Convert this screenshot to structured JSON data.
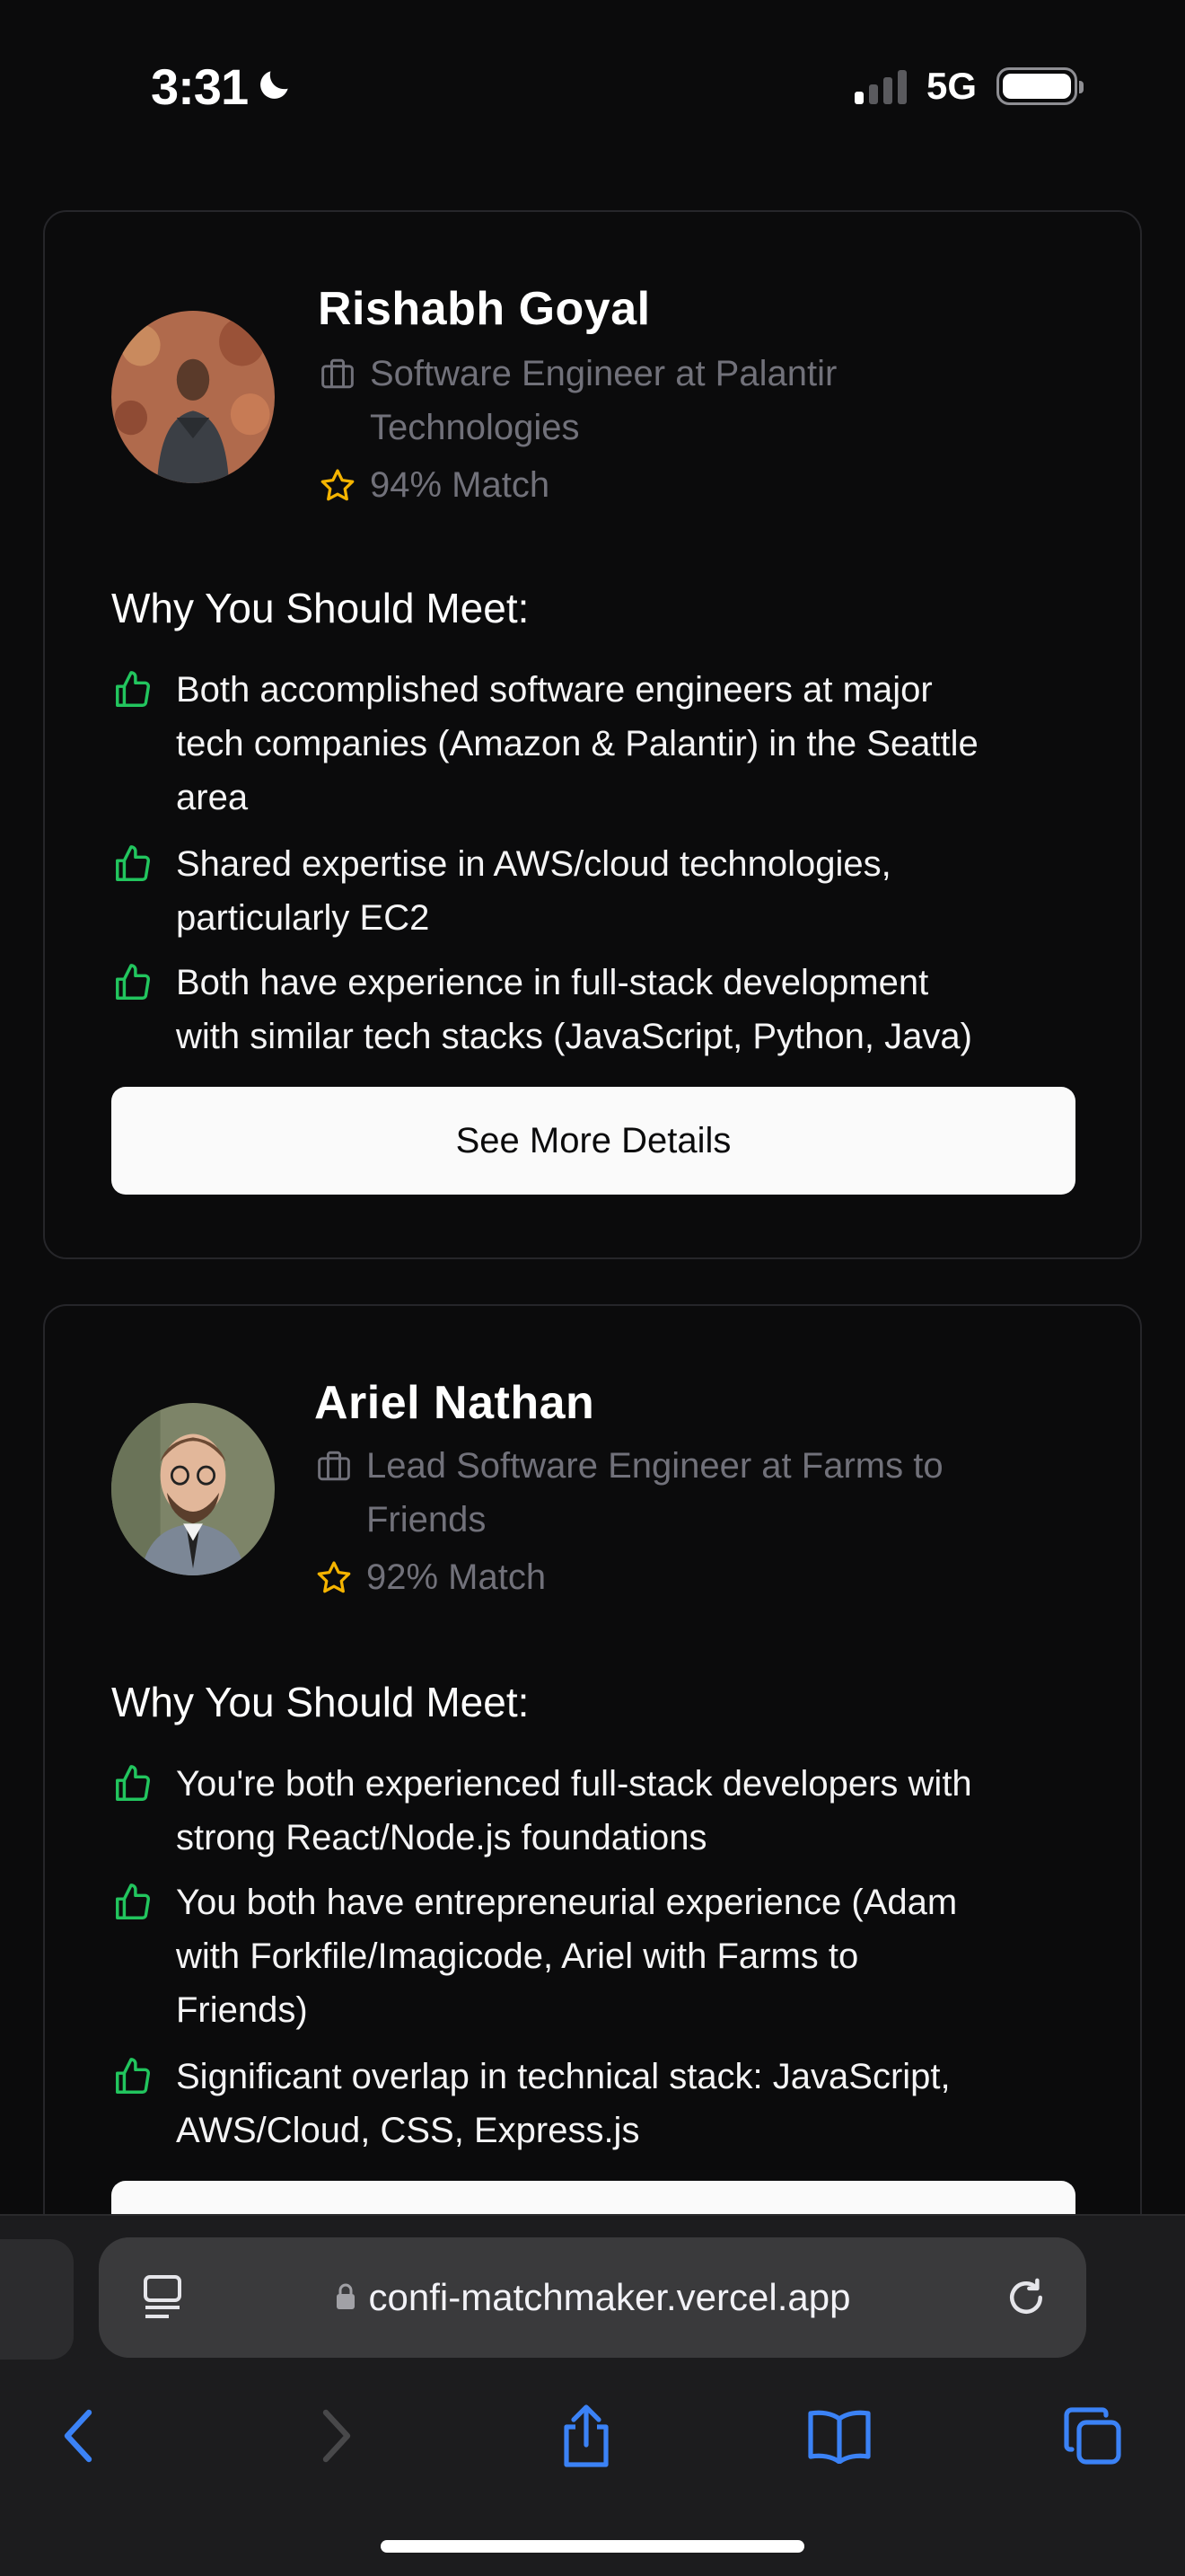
{
  "status_bar": {
    "time": "3:31",
    "network": "5G",
    "moon_icon": "moon-icon",
    "signal_bars_active": 1,
    "signal_bars_total": 4
  },
  "cards": [
    {
      "name": "Rishabh Goyal",
      "role_line1": "Software Engineer at Palantir",
      "role_line2": "Technologies",
      "match": "94% Match",
      "why_title": "Why You Should Meet:",
      "reasons": [
        [
          "Both accomplished software engineers at major",
          "tech companies (Amazon & Palantir) in the Seattle",
          "area"
        ],
        [
          "Shared expertise in AWS/cloud technologies,",
          "particularly EC2"
        ],
        [
          "Both have experience in full-stack development",
          "with similar tech stacks (JavaScript, Python, Java)"
        ]
      ],
      "button_label": "See More Details"
    },
    {
      "name": "Ariel Nathan",
      "role_line1": "Lead Software Engineer at Farms to",
      "role_line2": "Friends",
      "match": "92% Match",
      "why_title": "Why You Should Meet:",
      "reasons": [
        [
          "You're both experienced full-stack developers with",
          "strong React/Node.js foundations"
        ],
        [
          "You both have entrepreneurial experience (Adam",
          "with Forkfile/Imagicode, Ariel with Farms to",
          "Friends)"
        ],
        [
          "Significant overlap in technical stack: JavaScript,",
          "AWS/Cloud, CSS, Express.js"
        ]
      ],
      "button_label": ""
    }
  ],
  "browser": {
    "url": "confi-matchmaker.vercel.app",
    "icons": [
      "reader-icon",
      "lock-icon",
      "reload-icon",
      "back-icon",
      "forward-icon",
      "share-icon",
      "bookmarks-icon",
      "tabs-icon"
    ]
  },
  "colors": {
    "background": "#0b0b0c",
    "card_border": "#26262a",
    "muted_text": "#71717a",
    "star": "#f5b400",
    "thumb": "#22c55e",
    "accent_blue": "#3b82f6"
  }
}
